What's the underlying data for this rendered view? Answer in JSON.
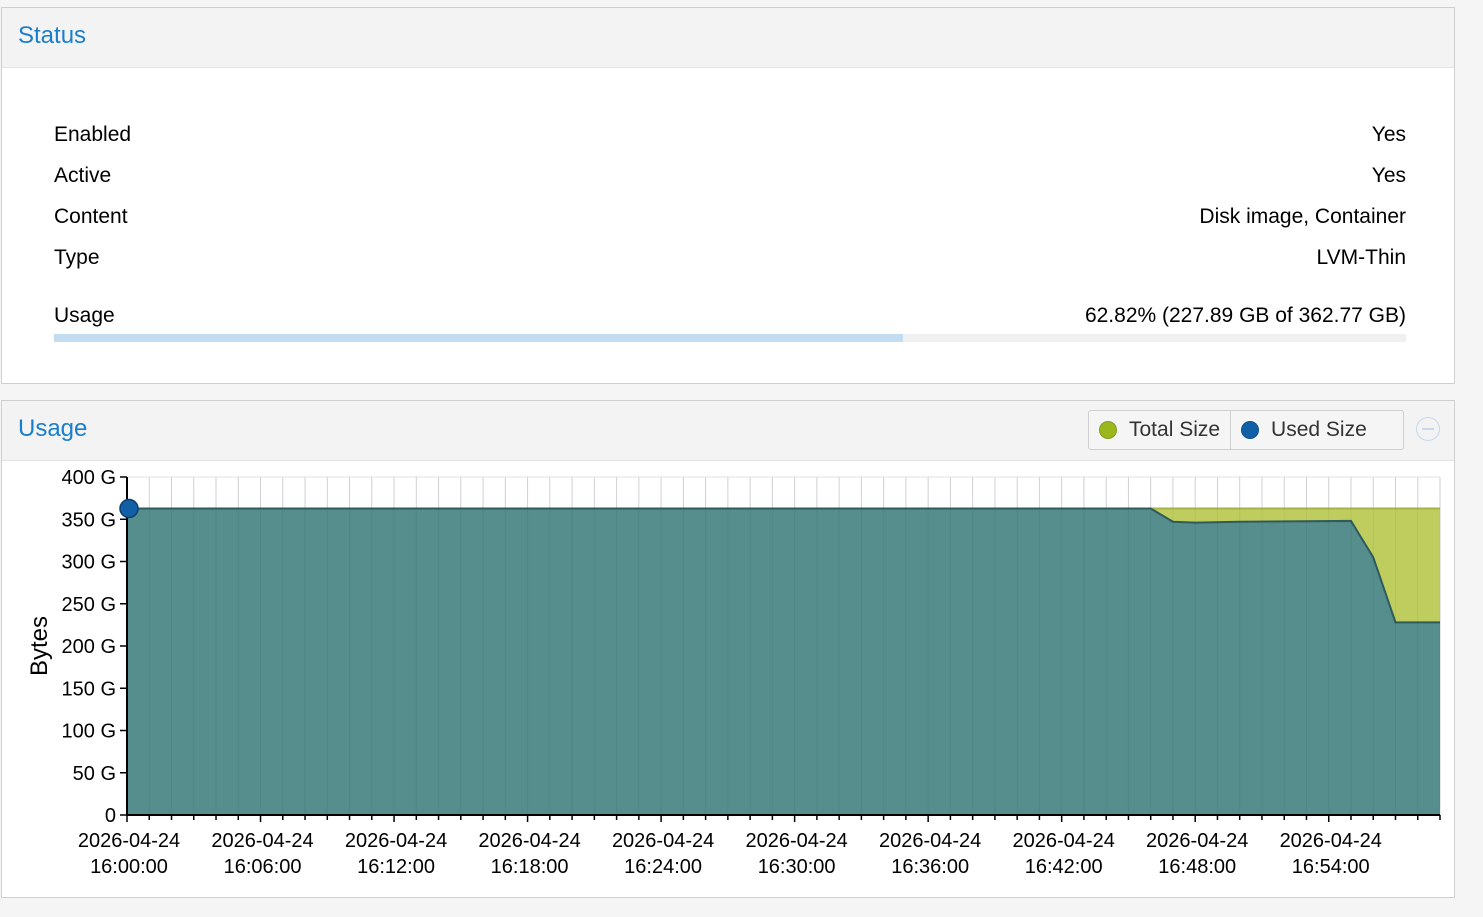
{
  "status": {
    "title": "Status",
    "rows": [
      {
        "key": "Enabled",
        "value": "Yes"
      },
      {
        "key": "Active",
        "value": "Yes"
      },
      {
        "key": "Content",
        "value": "Disk image, Container"
      },
      {
        "key": "Type",
        "value": "LVM-Thin"
      }
    ],
    "usage": {
      "key": "Usage",
      "value": "62.82% (227.89 GB of 362.77 GB)",
      "fraction": 0.6282
    }
  },
  "usage_panel": {
    "title": "Usage",
    "legend": [
      {
        "label": "Total Size",
        "color": "#9ab81e"
      },
      {
        "label": "Used Size",
        "color": "#115fa6"
      }
    ]
  },
  "chart_data": {
    "type": "area",
    "ylabel": "Bytes",
    "ylim": [
      0,
      400
    ],
    "yticks": [
      "0",
      "50 G",
      "100 G",
      "150 G",
      "200 G",
      "250 G",
      "300 G",
      "350 G",
      "400 G"
    ],
    "xticks": [
      [
        "2026-04-24",
        "16:00:00"
      ],
      [
        "2026-04-24",
        "16:06:00"
      ],
      [
        "2026-04-24",
        "16:12:00"
      ],
      [
        "2026-04-24",
        "16:18:00"
      ],
      [
        "2026-04-24",
        "16:24:00"
      ],
      [
        "2026-04-24",
        "16:30:00"
      ],
      [
        "2026-04-24",
        "16:36:00"
      ],
      [
        "2026-04-24",
        "16:42:00"
      ],
      [
        "2026-04-24",
        "16:48:00"
      ],
      [
        "2026-04-24",
        "16:54:00"
      ]
    ],
    "x_unit": "minutes after 16:00:00",
    "x_max": 59,
    "grid": true,
    "series": [
      {
        "name": "Total Size",
        "color": "#bfcd5f",
        "x": [
          0,
          46,
          59
        ],
        "values": [
          362.77,
          362.77,
          362.77
        ]
      },
      {
        "name": "Used Size",
        "color": "#558e8c",
        "x": [
          0,
          46,
          47,
          48,
          50,
          55,
          56,
          57,
          59
        ],
        "values": [
          362.77,
          362.77,
          347,
          346,
          347,
          348,
          305,
          228,
          228
        ]
      }
    ]
  }
}
